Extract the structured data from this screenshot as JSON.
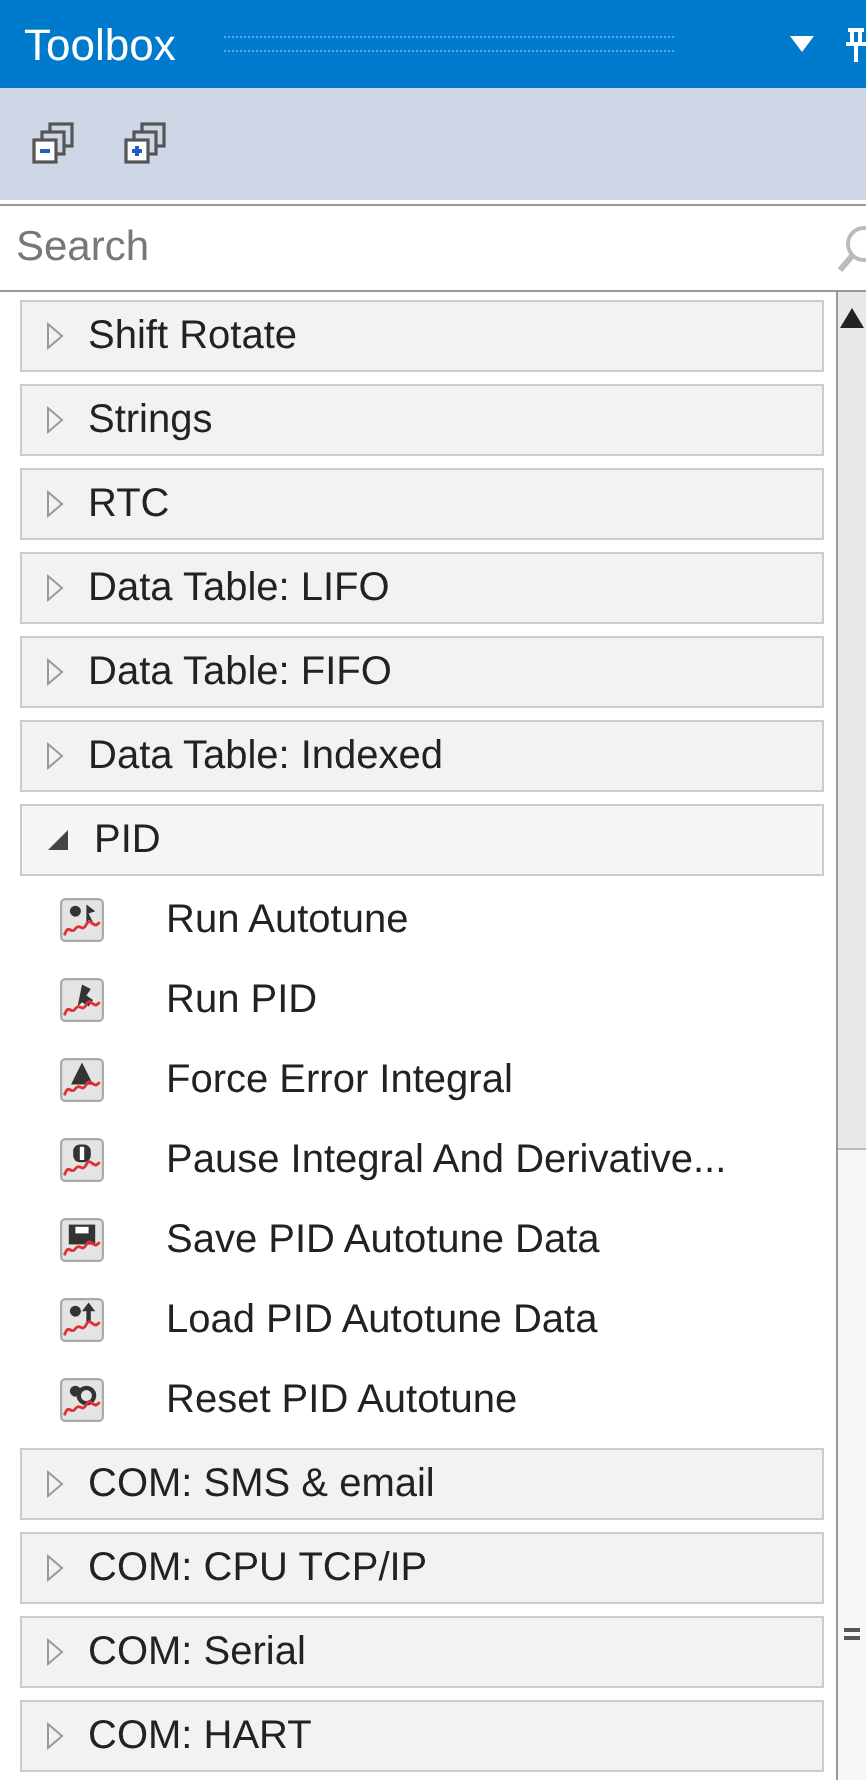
{
  "window": {
    "title": "Toolbox"
  },
  "search": {
    "placeholder": "Search"
  },
  "groups": [
    {
      "label": "Shift Rotate",
      "expanded": false
    },
    {
      "label": "Strings",
      "expanded": false
    },
    {
      "label": "RTC",
      "expanded": false
    },
    {
      "label": "Data Table: LIFO",
      "expanded": false
    },
    {
      "label": "Data Table: FIFO",
      "expanded": false
    },
    {
      "label": "Data Table: Indexed",
      "expanded": false
    },
    {
      "label": "PID",
      "expanded": true,
      "children": [
        {
          "label": "Run Autotune",
          "kind": "autotune"
        },
        {
          "label": "Run PID",
          "kind": "run"
        },
        {
          "label": "Force Error Integral",
          "kind": "force"
        },
        {
          "label": "Pause Integral And Derivative...",
          "kind": "pause"
        },
        {
          "label": "Save PID Autotune Data",
          "kind": "save"
        },
        {
          "label": "Load PID Autotune Data",
          "kind": "load"
        },
        {
          "label": "Reset PID Autotune",
          "kind": "reset"
        }
      ]
    },
    {
      "label": "COM: SMS & email",
      "expanded": false
    },
    {
      "label": "COM: CPU TCP/IP",
      "expanded": false
    },
    {
      "label": "COM: Serial",
      "expanded": false
    },
    {
      "label": "COM: HART",
      "expanded": false
    }
  ]
}
